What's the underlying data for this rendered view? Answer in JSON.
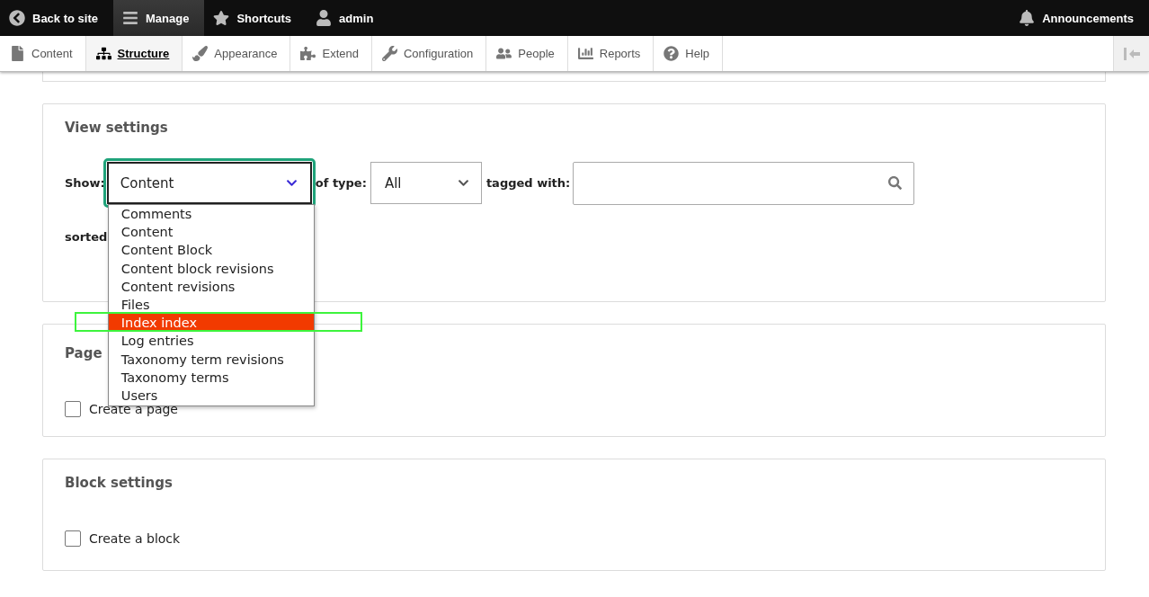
{
  "toolbar": {
    "items": [
      {
        "label": "Back to site",
        "selected": false
      },
      {
        "label": "Manage",
        "selected": true
      },
      {
        "label": "Shortcuts",
        "selected": false
      },
      {
        "label": "admin",
        "selected": false
      }
    ],
    "announcements": "Announcements"
  },
  "menu": [
    {
      "label": "Content",
      "selected": false
    },
    {
      "label": "Structure",
      "selected": true
    },
    {
      "label": "Appearance",
      "selected": false
    },
    {
      "label": "Extend",
      "selected": false
    },
    {
      "label": "Configuration",
      "selected": false
    },
    {
      "label": "People",
      "selected": false
    },
    {
      "label": "Reports",
      "selected": false
    },
    {
      "label": "Help",
      "selected": false
    }
  ],
  "view_settings": {
    "title": "View settings",
    "show": {
      "label": "Show:",
      "value": "Content",
      "options": [
        {
          "label": "Comments",
          "highlighted": false
        },
        {
          "label": "Content",
          "highlighted": false
        },
        {
          "label": "Content Block",
          "highlighted": false
        },
        {
          "label": "Content block revisions",
          "highlighted": false
        },
        {
          "label": "Content revisions",
          "highlighted": false
        },
        {
          "label": "Files",
          "highlighted": false
        },
        {
          "label": "Index index",
          "highlighted": true
        },
        {
          "label": "Log entries",
          "highlighted": false
        },
        {
          "label": "Taxonomy term revisions",
          "highlighted": false
        },
        {
          "label": "Taxonomy terms",
          "highlighted": false
        },
        {
          "label": "Users",
          "highlighted": false
        }
      ]
    },
    "type": {
      "label": "of type:",
      "value": "All"
    },
    "tagged": {
      "label": "tagged with:"
    },
    "sorted": {
      "label": "sorted"
    }
  },
  "page_settings": {
    "title": "Page",
    "checkbox": {
      "label": "Create a page",
      "checked": false
    }
  },
  "block_settings": {
    "title": "Block settings",
    "checkbox": {
      "label": "Create a block",
      "checked": false
    }
  }
}
